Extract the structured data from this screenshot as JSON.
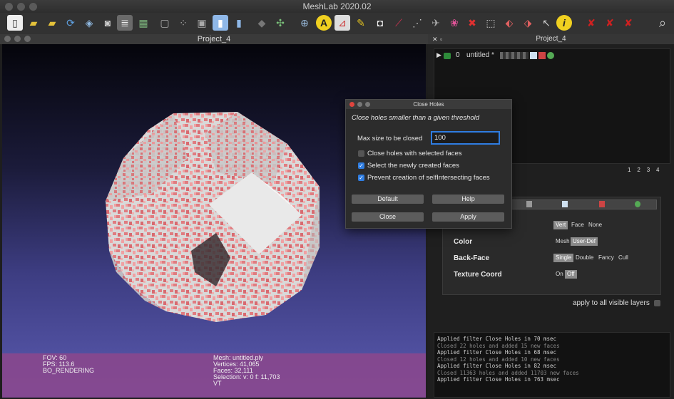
{
  "app": {
    "title": "MeshLab 2020.02"
  },
  "left_panel": {
    "title": "Project_4"
  },
  "right_panel": {
    "title": "Project_4"
  },
  "hud": {
    "fov": "FOV: 60",
    "fps": "FPS:   113.6",
    "mode": "BO_RENDERING",
    "mesh": "Mesh: untitled.ply",
    "vertices": "Vertices: 41,065",
    "faces": "Faces: 32,111",
    "selection": "Selection: v: 0 f: 11,703",
    "vt": "VT"
  },
  "layers": {
    "index": "0",
    "name": "untitled *"
  },
  "render_options": {
    "view_numbers": [
      "1",
      "2",
      "3",
      "4"
    ],
    "rows": [
      {
        "label": "Color",
        "options": [
          "Mesh",
          "User-Def"
        ],
        "selected": "User-Def"
      },
      {
        "label": "Back-Face",
        "options": [
          "Single",
          "Double",
          "Fancy",
          "Cull"
        ],
        "selected": "Single"
      },
      {
        "label": "Texture Coord",
        "options": [
          "On",
          "Off"
        ],
        "selected": "Off"
      }
    ],
    "shading_options": [
      "Vert",
      "Face",
      "None"
    ],
    "shading_selected": "Vert",
    "apply_all": "apply to all visible layers"
  },
  "log": [
    "Applied filter Close Holes in 70 msec",
    "Closed 22 holes and added 15 new faces",
    "Applied filter Close Holes in 68 msec",
    "Closed 12 holes and added 10 new faces",
    "Applied filter Close Holes in 82 msec",
    "Closed 11363 holes and added 11703 new faces",
    "Applied filter Close Holes in 763 msec"
  ],
  "dialog": {
    "title": "Close Holes",
    "description": "Close holes smaller than a given threshold",
    "max_size_label": "Max size to be closed",
    "max_size_value": "100",
    "checkboxes": [
      {
        "label": "Close holes with selected faces",
        "checked": false
      },
      {
        "label": "Select the newly created faces",
        "checked": true
      },
      {
        "label": "Prevent creation of selfIntersecting faces",
        "checked": true
      }
    ],
    "buttons": {
      "default": "Default",
      "help": "Help",
      "close": "Close",
      "apply": "Apply"
    }
  },
  "colors": {
    "accent": "#2f7de1",
    "mesh_pink": "#e47f82",
    "mesh_white": "#d8d8d8",
    "hud_bg": "#8c468c"
  }
}
